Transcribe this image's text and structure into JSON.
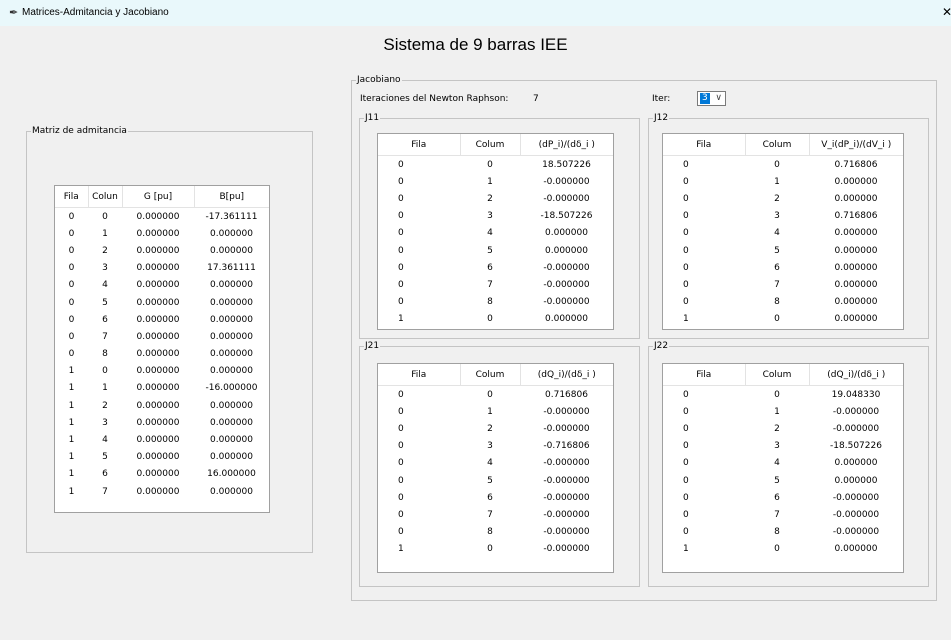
{
  "window": {
    "title": "Matrices-Admitancia y Jacobiano",
    "close_label": "✕",
    "app_icon": "feather-icon"
  },
  "heading": "Sistema de 9 barras IEE",
  "admittance": {
    "frame_label": "Matriz de admitancia",
    "headers": [
      "Fila",
      "Colun",
      "G [pu]",
      "B[pu]"
    ],
    "rows": [
      [
        "0",
        "0",
        "0.000000",
        "-17.361111"
      ],
      [
        "0",
        "1",
        "0.000000",
        "0.000000"
      ],
      [
        "0",
        "2",
        "0.000000",
        "0.000000"
      ],
      [
        "0",
        "3",
        "0.000000",
        "17.361111"
      ],
      [
        "0",
        "4",
        "0.000000",
        "0.000000"
      ],
      [
        "0",
        "5",
        "0.000000",
        "0.000000"
      ],
      [
        "0",
        "6",
        "0.000000",
        "0.000000"
      ],
      [
        "0",
        "7",
        "0.000000",
        "0.000000"
      ],
      [
        "0",
        "8",
        "0.000000",
        "0.000000"
      ],
      [
        "1",
        "0",
        "0.000000",
        "0.000000"
      ],
      [
        "1",
        "1",
        "0.000000",
        "-16.000000"
      ],
      [
        "1",
        "2",
        "0.000000",
        "0.000000"
      ],
      [
        "1",
        "3",
        "0.000000",
        "0.000000"
      ],
      [
        "1",
        "4",
        "0.000000",
        "0.000000"
      ],
      [
        "1",
        "5",
        "0.000000",
        "0.000000"
      ],
      [
        "1",
        "6",
        "0.000000",
        "16.000000"
      ],
      [
        "1",
        "7",
        "0.000000",
        "0.000000"
      ]
    ]
  },
  "jacobian": {
    "frame_label": "Jacobiano",
    "iterations_label": "Iteraciones del Newton Raphson:",
    "iterations_value": "7",
    "iter_label": "Iter:",
    "iter_selected": "3",
    "j11": {
      "label": "J11",
      "headers": [
        "Fila",
        "Colum",
        "(dP_i)/(dδ_i )"
      ],
      "rows": [
        [
          "0",
          "0",
          "18.507226"
        ],
        [
          "0",
          "1",
          "-0.000000"
        ],
        [
          "0",
          "2",
          "-0.000000"
        ],
        [
          "0",
          "3",
          "-18.507226"
        ],
        [
          "0",
          "4",
          "0.000000"
        ],
        [
          "0",
          "5",
          "0.000000"
        ],
        [
          "0",
          "6",
          "-0.000000"
        ],
        [
          "0",
          "7",
          "-0.000000"
        ],
        [
          "0",
          "8",
          "-0.000000"
        ],
        [
          "1",
          "0",
          "0.000000"
        ]
      ]
    },
    "j12": {
      "label": "J12",
      "headers": [
        "Fila",
        "Colum",
        "V_i(dP_i)/(dV_i )"
      ],
      "rows": [
        [
          "0",
          "0",
          "0.716806"
        ],
        [
          "0",
          "1",
          "0.000000"
        ],
        [
          "0",
          "2",
          "0.000000"
        ],
        [
          "0",
          "3",
          "0.716806"
        ],
        [
          "0",
          "4",
          "0.000000"
        ],
        [
          "0",
          "5",
          "0.000000"
        ],
        [
          "0",
          "6",
          "0.000000"
        ],
        [
          "0",
          "7",
          "0.000000"
        ],
        [
          "0",
          "8",
          "0.000000"
        ],
        [
          "1",
          "0",
          "0.000000"
        ]
      ]
    },
    "j21": {
      "label": "J21",
      "headers": [
        "Fila",
        "Colum",
        "(dQ_i)/(dδ_i )"
      ],
      "rows": [
        [
          "0",
          "0",
          "0.716806"
        ],
        [
          "0",
          "1",
          "-0.000000"
        ],
        [
          "0",
          "2",
          "-0.000000"
        ],
        [
          "0",
          "3",
          "-0.716806"
        ],
        [
          "0",
          "4",
          "-0.000000"
        ],
        [
          "0",
          "5",
          "-0.000000"
        ],
        [
          "0",
          "6",
          "-0.000000"
        ],
        [
          "0",
          "7",
          "-0.000000"
        ],
        [
          "0",
          "8",
          "-0.000000"
        ],
        [
          "1",
          "0",
          "-0.000000"
        ]
      ]
    },
    "j22": {
      "label": "J22",
      "headers": [
        "Fila",
        "Colum",
        "(dQ_i)/(dδ_i )"
      ],
      "rows": [
        [
          "0",
          "0",
          "19.048330"
        ],
        [
          "0",
          "1",
          "-0.000000"
        ],
        [
          "0",
          "2",
          "-0.000000"
        ],
        [
          "0",
          "3",
          "-18.507226"
        ],
        [
          "0",
          "4",
          "0.000000"
        ],
        [
          "0",
          "5",
          "0.000000"
        ],
        [
          "0",
          "6",
          "-0.000000"
        ],
        [
          "0",
          "7",
          "-0.000000"
        ],
        [
          "0",
          "8",
          "-0.000000"
        ],
        [
          "1",
          "0",
          "0.000000"
        ]
      ]
    }
  }
}
